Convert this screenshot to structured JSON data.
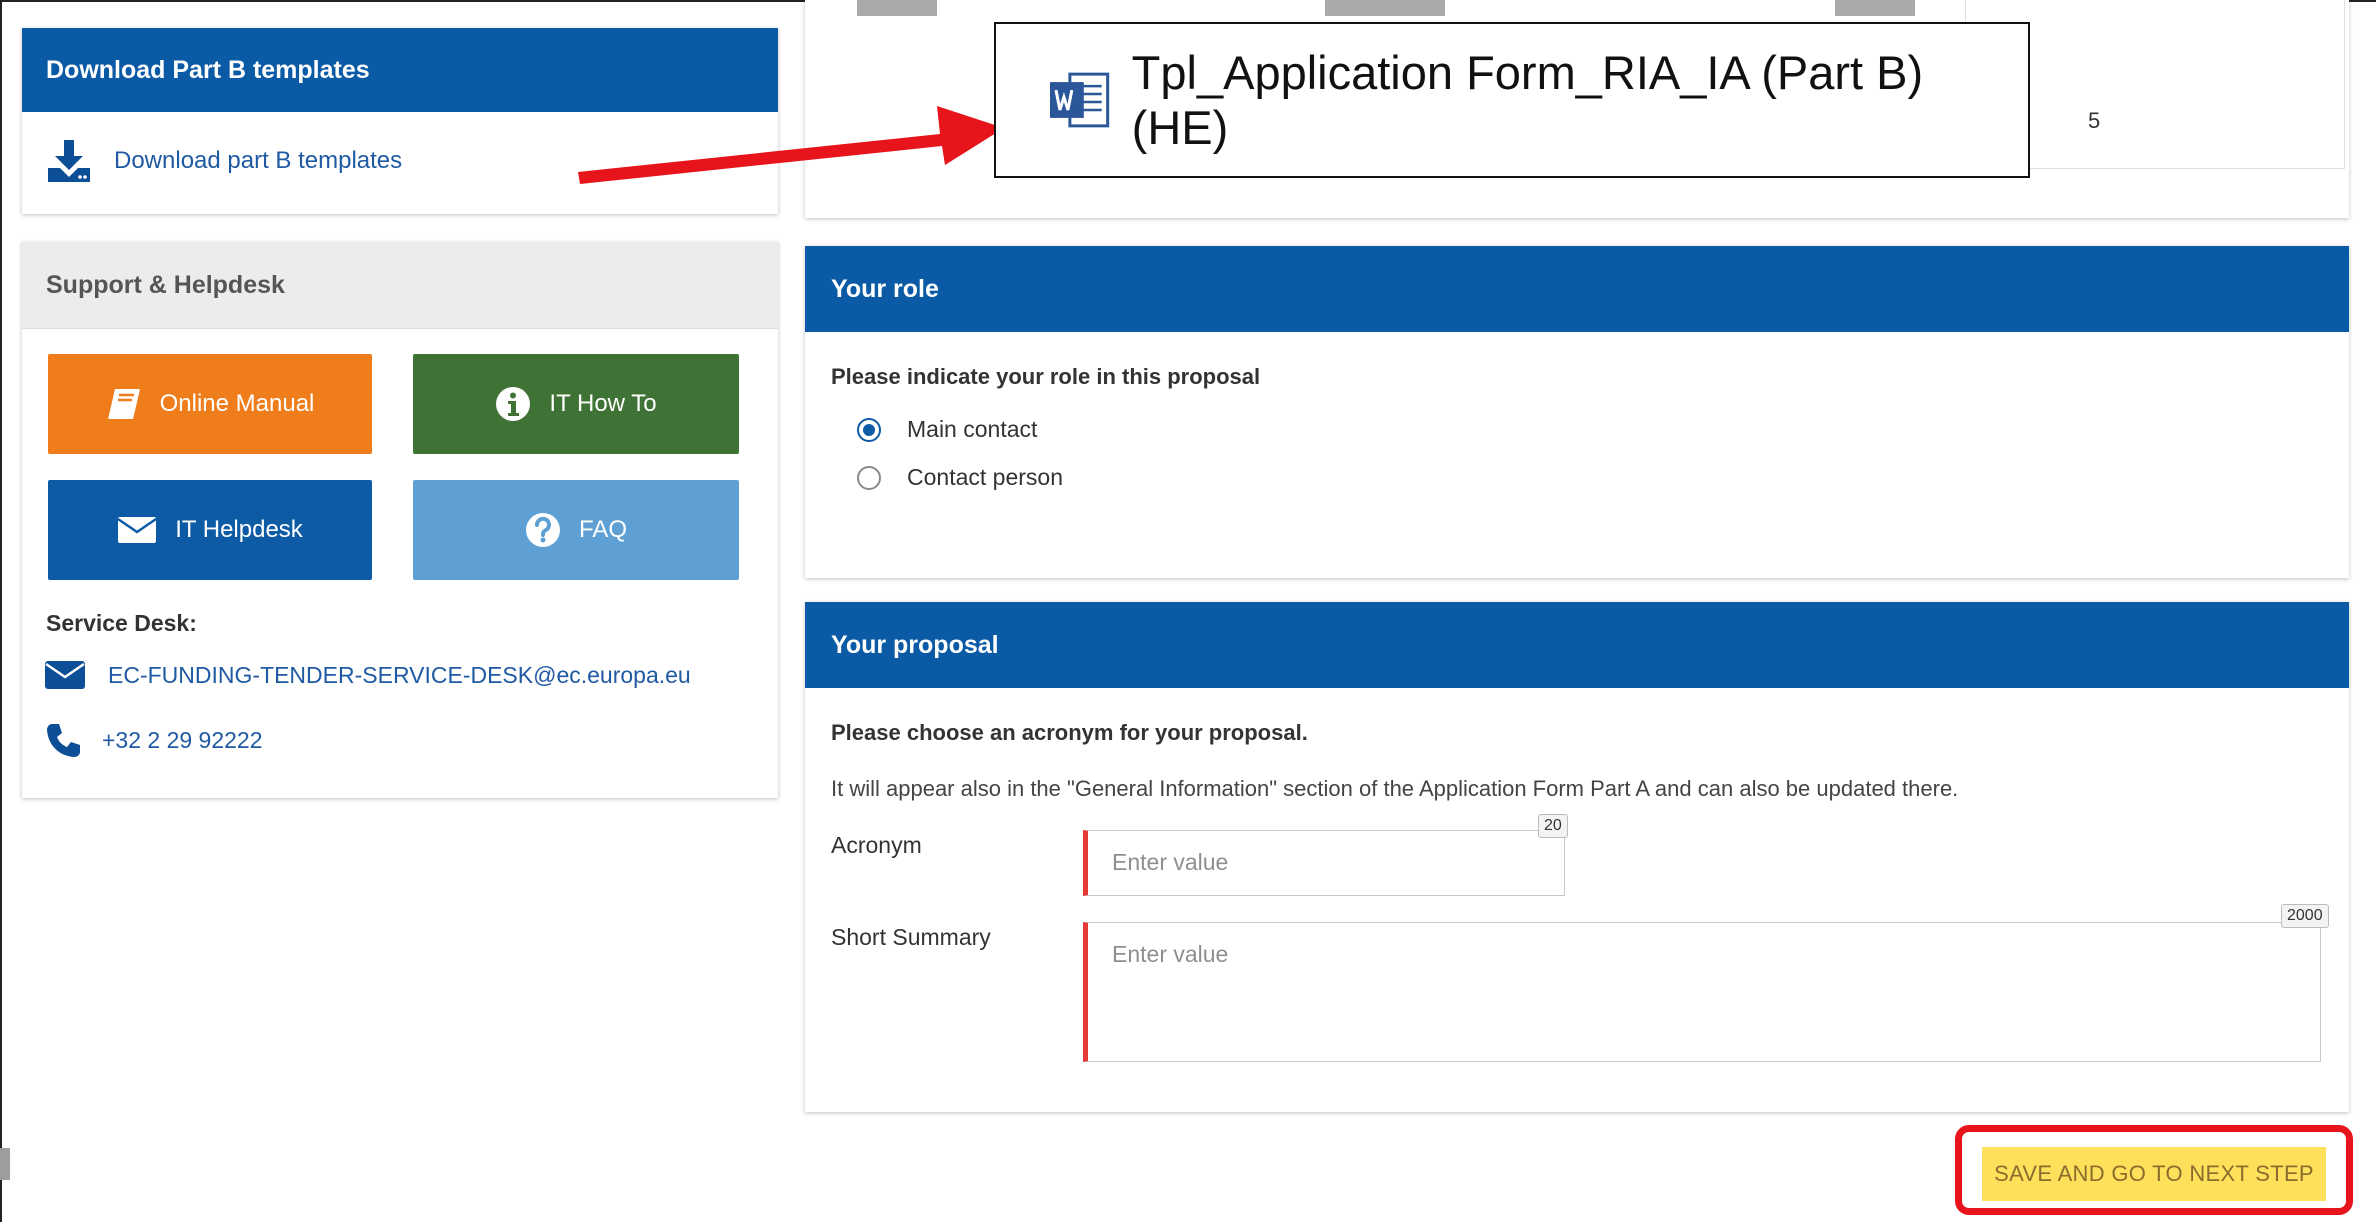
{
  "download_card": {
    "title": "Download Part B templates",
    "link_label": "Download part B templates",
    "link_icon": "download-icon"
  },
  "support_card": {
    "title": "Support & Helpdesk",
    "buttons": [
      {
        "label": "Online Manual",
        "icon": "book-icon",
        "color": "#ef7d1c"
      },
      {
        "label": "IT How To",
        "icon": "info-circle-icon",
        "color": "#3f7335"
      },
      {
        "label": "IT Helpdesk",
        "icon": "envelope-icon",
        "color": "#0d5aa5"
      },
      {
        "label": "FAQ",
        "icon": "question-circle-icon",
        "color": "#5ea0d3"
      }
    ],
    "service_desk_label": "Service Desk:",
    "email": "EC-FUNDING-TENDER-SERVICE-DESK@ec.europa.eu",
    "phone": "+32 2 29 92222"
  },
  "top_strip": {
    "partial_digit": "5"
  },
  "template_callout": {
    "file_name": "Tpl_Application Form_RIA_IA (Part B) (HE)",
    "file_icon": "word-document-icon"
  },
  "role_section": {
    "title": "Your role",
    "question": "Please indicate your role in this proposal",
    "options": [
      {
        "label": "Main contact",
        "selected": true
      },
      {
        "label": "Contact person",
        "selected": false
      }
    ]
  },
  "proposal_section": {
    "title": "Your proposal",
    "question": "Please choose an acronym for your proposal.",
    "helper_text": "It will appear also in the \"General Information\" section of the Application Form Part A and can also be updated there.",
    "acronym": {
      "label": "Acronym",
      "placeholder": "Enter value",
      "value": "",
      "max_length": "20"
    },
    "summary": {
      "label": "Short Summary",
      "placeholder": "Enter value",
      "value": "",
      "max_length": "2000"
    }
  },
  "actions": {
    "save_next_label": "SAVE AND GO TO NEXT STEP"
  },
  "colors": {
    "primary_blue": "#0a5aa5",
    "highlight_red": "#e8141b",
    "save_yellow": "#ffe05a"
  }
}
